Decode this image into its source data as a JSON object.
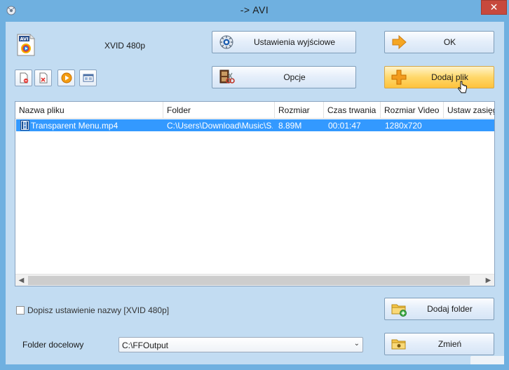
{
  "window": {
    "title": "-> AVI",
    "close_label": "✕"
  },
  "format": {
    "icon_text": "AVI",
    "label": "XVID 480p"
  },
  "buttons": {
    "output_settings": "Ustawienia wyjściowe",
    "ok": "OK",
    "options": "Opcje",
    "add_file": "Dodaj plik",
    "add_folder": "Dodaj folder",
    "change": "Zmień"
  },
  "file_list": {
    "columns": [
      "Nazwa pliku",
      "Folder",
      "Rozmiar",
      "Czas trwania",
      "Rozmiar Video",
      "Ustaw zasięg"
    ],
    "rows": [
      {
        "name": "Transparent Menu.mp4",
        "folder": "C:\\Users\\Download\\Music\\S...",
        "size": "8.89M",
        "duration": "00:01:47",
        "video_size": "1280x720",
        "range": ""
      }
    ]
  },
  "append_setting": {
    "label": "Dopisz ustawienie nazwy [XVID 480p]",
    "checked": false
  },
  "destination": {
    "label": "Folder docelowy",
    "value": "C:\\FFOutput"
  },
  "colors": {
    "title_bar": "#6fb0e0",
    "client_bg": "#c2dcf2",
    "selected_row": "#3399ff",
    "close_button": "#c7493d",
    "hot_button": "#ffd86a"
  }
}
